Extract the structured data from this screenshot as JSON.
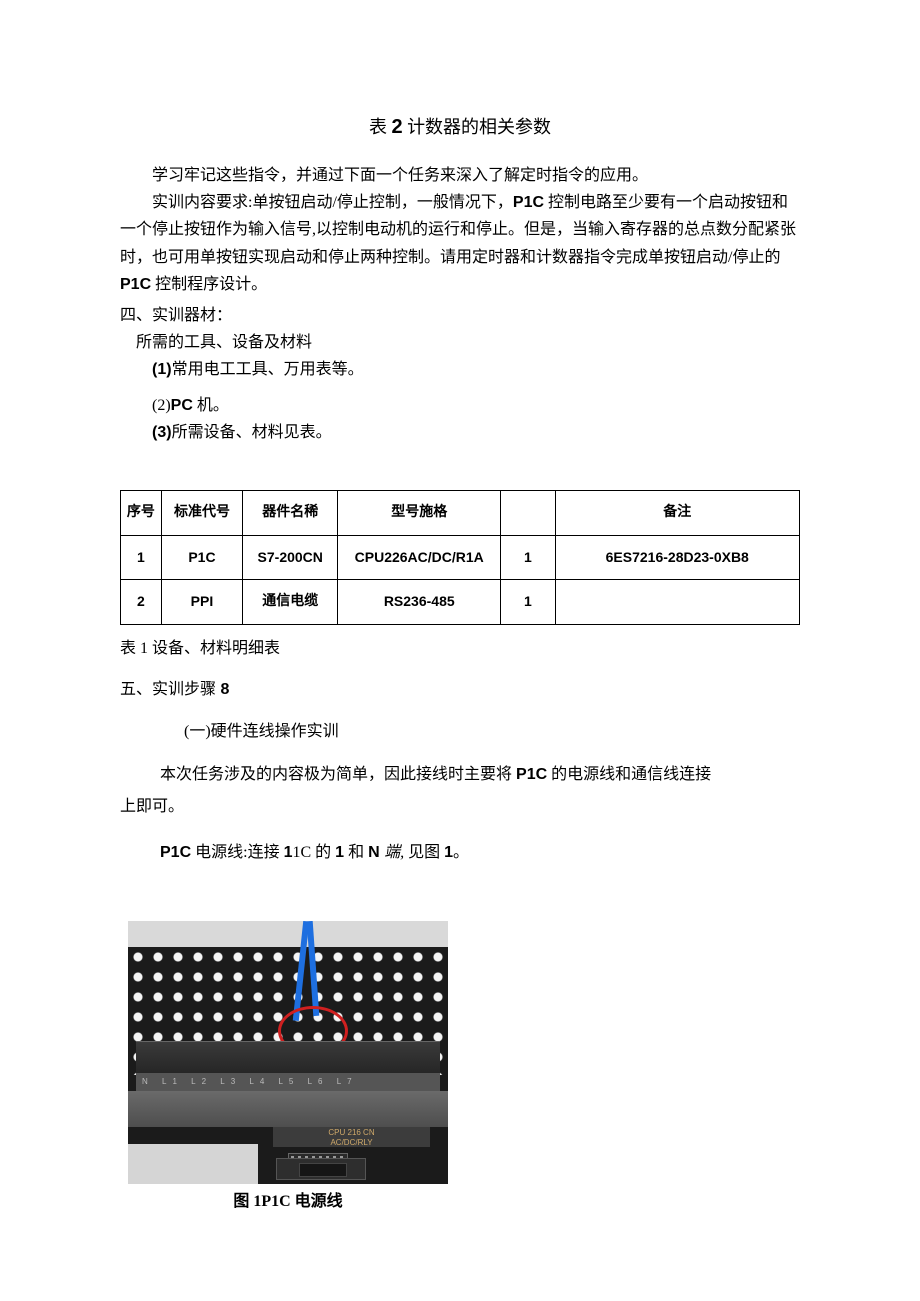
{
  "title_prefix": "表 ",
  "title_number": "2",
  "title_suffix": " 计数器的相关参数",
  "para1": "学习牢记这些指令，并通过下面一个任务来深入了解定时指令的应用。",
  "para2a": "实训内容要求:单按钮启动/停止控制，一般情况下，",
  "para2_plc": "P1C",
  "para2b": " 控制电路至少要有一个启动按钮和一个停止按钮作为输入信号,以控制电动机的运行和停止。但是，当输入寄存器的总点数分配紧张时，也可用单按钮实现启动和停止两种控制。请用定时器和计数器指令完成单按钮启动/停止的 ",
  "para2_plc2": "P1C",
  "para2c": " 控制程序设计。",
  "sec4_head": "四、实训器材：",
  "sec4_line1": "所需的工具、设备及材料",
  "sec4_item1_num": "(1)",
  "sec4_item1_text": "常用电工工具、万用表等。",
  "sec4_item2_num": "(2)",
  "sec4_item2_en": "PC",
  "sec4_item2_text": " 机。",
  "sec4_item3_num": "(3)",
  "sec4_item3_text": "所需设备、材料见表。",
  "table": {
    "headers": [
      "序号",
      "标准代号",
      "器件名稀",
      "型号施格",
      "",
      "备注"
    ],
    "rows": [
      [
        "1",
        "P1C",
        "S7-200CN",
        "CPU226AC/DC/R1A",
        "1",
        "6ES7216-28D23-0XB8"
      ],
      [
        "2",
        "PPI",
        "通信电缆",
        "RS236-485",
        "1",
        ""
      ]
    ]
  },
  "table_caption_bold": "表 1",
  "table_caption_rest": " 设备、材料明细表",
  "sec5_head_a": "五、实训步骤",
  "sec5_head_num": " 8",
  "sec5_sub": "(一)硬件连线操作实训",
  "body1a": "本次任务涉及的内容极为简单，因此接线时主要将 ",
  "body1_plc": "P1C",
  "body1b": " 的电源线和通信线连接",
  "body1_line2": "上即可。",
  "body2_plc": "P1C",
  "body2a": " 电源线:连接 ",
  "body2_num": "1",
  "body2_b": "1C",
  "body2_c": " 的 ",
  "body2_one": "1",
  "body2_and": " 和 ",
  "body2_n": "N ",
  "body2_end_italic": "端,",
  "body2_end": " 见图 ",
  "body2_fig": "1",
  "body2_period": "。",
  "cpu_label_line1": "CPU 216 CN",
  "cpu_label_line2": "AC/DC/RLY",
  "fig_caption_a": "图 ",
  "fig_caption_num": "1P1C",
  "fig_caption_b": " 电源线"
}
